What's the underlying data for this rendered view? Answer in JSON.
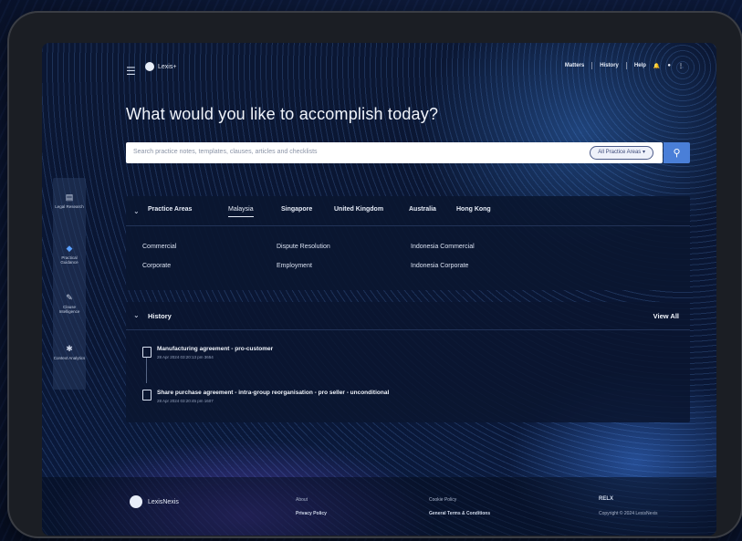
{
  "header": {
    "app_name": "Lexis+",
    "nav_links": [
      "Matters",
      "History",
      "Help"
    ],
    "nav_icons": [
      "bell-icon",
      "user-icon",
      "more-icon"
    ]
  },
  "headline": "What would you like to accomplish today?",
  "search": {
    "placeholder": "Search practice notes, templates, clauses, articles and checklists",
    "area_filter": "All Practice Areas",
    "button_icon": "search-icon"
  },
  "sidebar": {
    "items": [
      {
        "label": "Legal Research",
        "icon": "book-icon"
      },
      {
        "label": "Practical Guidance",
        "icon": "shield-icon"
      },
      {
        "label": "Clause Intelligence",
        "icon": "pen-icon"
      },
      {
        "label": "Context Analytics",
        "icon": "network-icon"
      }
    ]
  },
  "practice": {
    "title": "Practice Areas",
    "tabs": [
      "Malaysia",
      "Singapore",
      "United Kingdom",
      "Australia",
      "Hong Kong"
    ],
    "active_tab": "Malaysia",
    "col1": [
      "Commercial",
      "Corporate"
    ],
    "col2": [
      "Dispute Resolution",
      "Employment"
    ],
    "col3": [
      "Indonesia Commercial",
      "Indonesia Corporate"
    ]
  },
  "history": {
    "title": "History",
    "view_all": "View All",
    "items": [
      {
        "title": "Manufacturing agreement - pro-customer",
        "date": "28 Apr 2024 03:20:13 pm 3654"
      },
      {
        "title": "Share purchase agreement - intra-group reorganisation - pro seller - unconditional",
        "date": "28 Apr 2024 03:20:45 pm 1607"
      }
    ]
  },
  "footer": {
    "brand": "LexisNexis",
    "col1": [
      "About",
      "Privacy Policy"
    ],
    "col2": [
      "Cookie Policy",
      "General Terms & Conditions"
    ],
    "col3": [
      "RELX",
      "Copyright © 2024 LexisNexis"
    ]
  },
  "colors": {
    "accent": "#4a7fd8",
    "background": "#0b1733"
  }
}
